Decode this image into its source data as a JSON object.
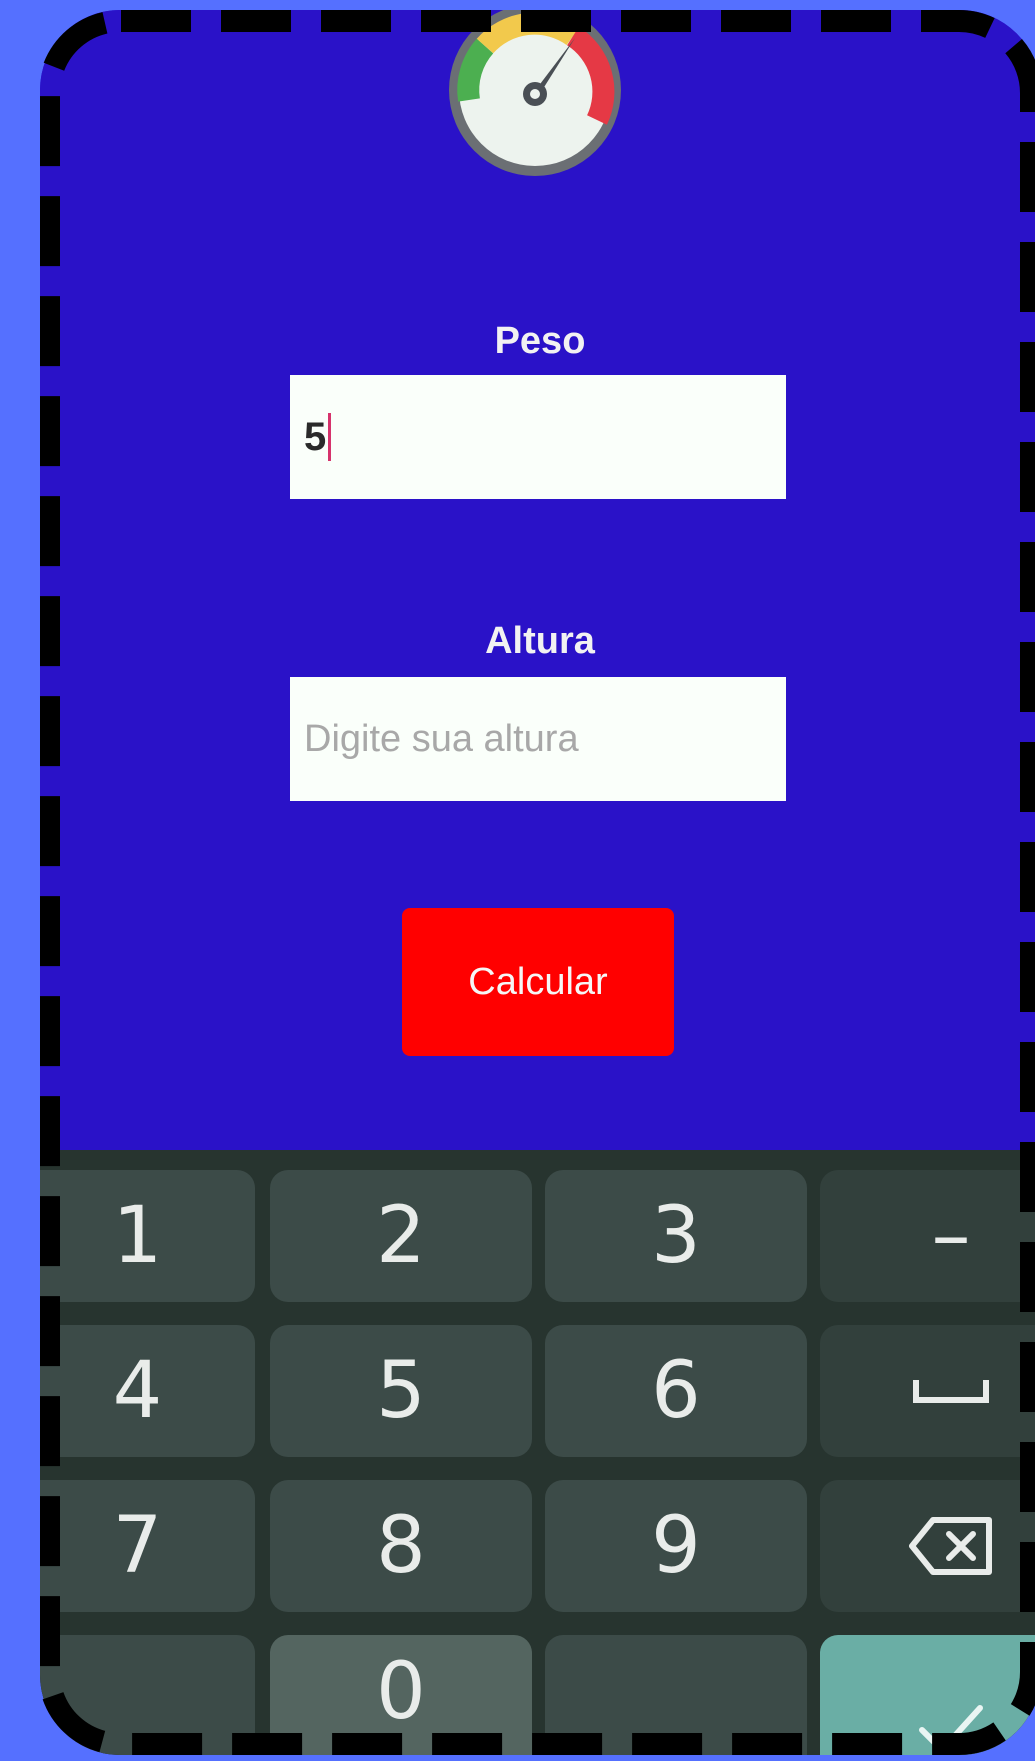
{
  "form": {
    "peso_label": "Peso",
    "peso_value": "5",
    "altura_label": "Altura",
    "altura_value": "",
    "altura_placeholder": "Digite sua altura",
    "calcular_label": "Calcular"
  },
  "keyboard": {
    "keys": [
      "1",
      "2",
      "3",
      "–",
      "4",
      "5",
      "6",
      "␣",
      "7",
      "8",
      "9",
      "⌫",
      ",",
      "0",
      ".",
      "✓"
    ]
  },
  "colors": {
    "background": "#2a12c8",
    "button": "#ff0000",
    "page_bg": "#5570ff",
    "keyboard_bg": "#27342f"
  },
  "icons": {
    "gauge": "speedometer-icon",
    "backspace": "backspace-icon",
    "space": "space-icon",
    "done": "checkmark-icon"
  }
}
